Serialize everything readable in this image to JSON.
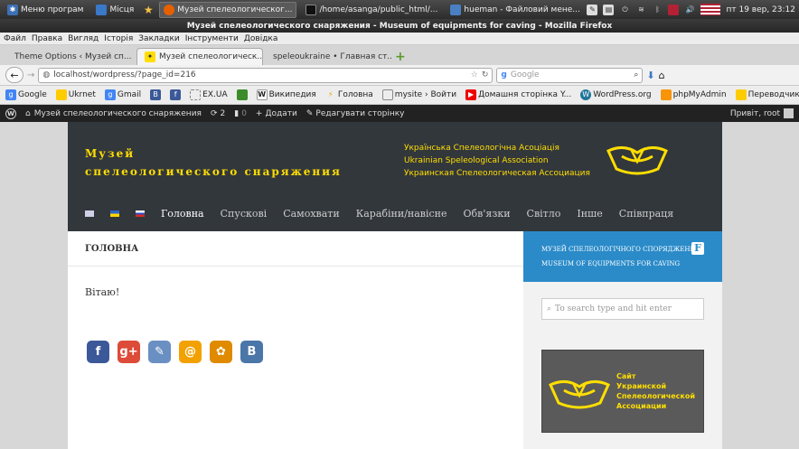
{
  "os_panel": {
    "menu_button": "Меню програм",
    "places": "Місця",
    "tasks": [
      {
        "label": "Музей спелеологическог...",
        "active": true
      },
      {
        "label": "/home/asanga/public_html/...",
        "active": false
      },
      {
        "label": "hueman - Файловий мене...",
        "active": false
      }
    ],
    "clock": "пт 19 вер, 23:12"
  },
  "window_title": "Музей спелеологического снаряжения - Museum of equipments for caving - Mozilla Firefox",
  "menu": [
    "Файл",
    "Правка",
    "Вигляд",
    "Історія",
    "Закладки",
    "Інструменти",
    "Довідка"
  ],
  "tabs": [
    {
      "label": "Theme Options ‹ Музей сп...",
      "active": false
    },
    {
      "label": "Музей спелеологическ...",
      "active": true
    },
    {
      "label": "speleoukraine • Главная ст...",
      "active": false
    }
  ],
  "url": "localhost/wordpress/?page_id=216",
  "search_placeholder": "Google",
  "bookmarks": [
    "Google",
    "Ukrnet",
    "Gmail",
    "",
    "",
    "EX.UA",
    "",
    "Википедия",
    "Головна",
    "mysite › Войти",
    "Домашня сторінка Y...",
    "WordPress.org",
    "phpMyAdmin",
    "Переводчик"
  ],
  "admin_bar": {
    "site_name": "Музей спелеологического снаряжения",
    "updates": "2",
    "comments": "0",
    "add": "Додати",
    "edit": "Редагувати сторінку",
    "greeting": "Привіт, root"
  },
  "site": {
    "title_line1": "Музей",
    "title_line2": "спелеологического снаряжения",
    "assoc_ua": "Українська Спелеологічна Асоціація",
    "assoc_en": "Ukrainian Speleological Association",
    "assoc_ru": "Украинская Спелеологическая Ассоциация",
    "nav": [
      "Головна",
      "Спускові",
      "Самохвати",
      "Карабіни/навісне",
      "Обв'язки",
      "Світло",
      "Інше",
      "Співпраця"
    ],
    "page_title": "ГОЛОВНА",
    "page_text": "Вітаю!",
    "share": [
      {
        "label": "f",
        "color": "#3b5998"
      },
      {
        "label": "g+",
        "color": "#dd4b39"
      },
      {
        "label": "✎",
        "color": "#6a8fc2"
      },
      {
        "label": "@",
        "color": "#f2a100"
      },
      {
        "label": "✿",
        "color": "#e08a00"
      },
      {
        "label": "B",
        "color": "#4a76a8"
      }
    ]
  },
  "sidebar": {
    "header_line1": "Музей спелеологічного спорядження",
    "header_line2": "Museum of equipments for caving",
    "search_placeholder": "To search type and hit enter",
    "banner_text": [
      "Сайт",
      "Украинской",
      "Спелеологической",
      "Ассоциации"
    ]
  }
}
